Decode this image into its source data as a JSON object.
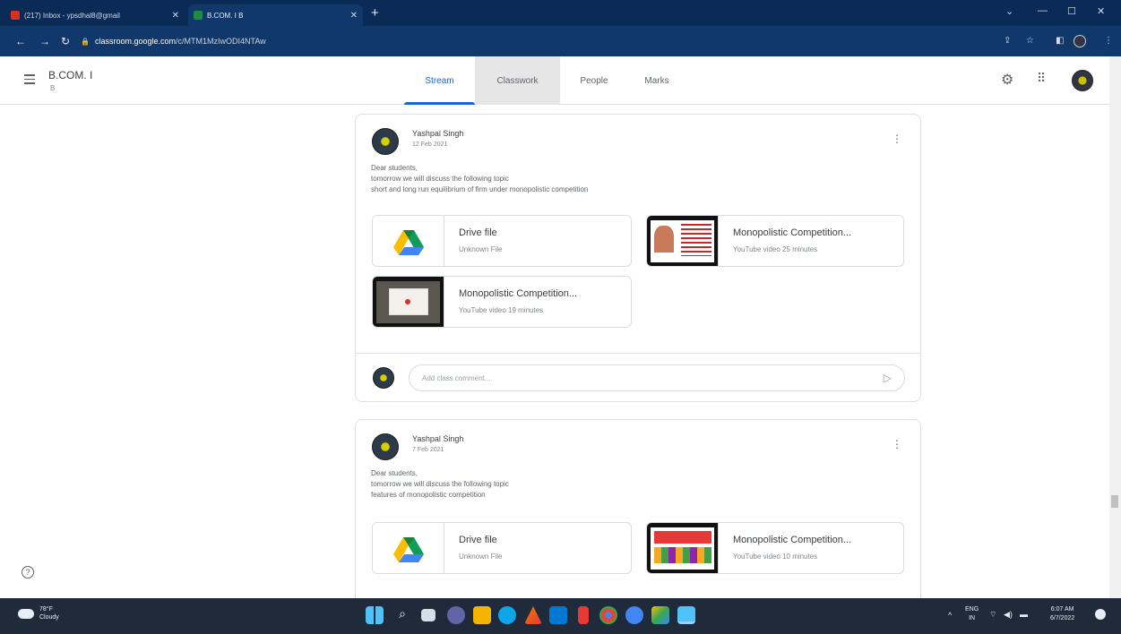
{
  "browser": {
    "tabs": [
      {
        "label": "(217) Inbox - ypsdhal8@gmail",
        "active": false
      },
      {
        "label": "B.COM. I B",
        "active": true
      }
    ],
    "url_host": "classroom.google.com",
    "url_path": "/c/MTM1MzIwODI4NTAw"
  },
  "app": {
    "class_name": "B.COM. I",
    "class_section": "B",
    "tabs": [
      "Stream",
      "Classwork",
      "People",
      "Marks"
    ],
    "active_tab": "Stream",
    "hovered_tab": "Classwork"
  },
  "posts": [
    {
      "author": "Yashpal Singh",
      "date": "12 Feb 2021",
      "lines": [
        "Dear students,",
        "tomorrow we will discuss the following topic",
        "short and long run equilibrium of firm under monopolistic competition"
      ],
      "attachments": [
        {
          "title": "Drive file",
          "subtitle": "Unknown File",
          "kind": "drive"
        },
        {
          "title": "Monopolistic Competition...",
          "subtitle": "YouTube video  25 minutes",
          "kind": "youtube"
        },
        {
          "title": "Monopolistic Competition...",
          "subtitle": "YouTube video  19 minutes",
          "kind": "youtube"
        }
      ],
      "comment_placeholder": "Add class comment..."
    },
    {
      "author": "Yashpal Singh",
      "date": "7 Feb 2021",
      "lines": [
        "Dear students,",
        "tomorrow we will discuss the following topic",
        "features of monopolistic competition"
      ],
      "attachments": [
        {
          "title": "Drive file",
          "subtitle": "Unknown File",
          "kind": "drive"
        },
        {
          "title": "Monopolistic Competition...",
          "subtitle": "YouTube video  10 minutes",
          "kind": "youtube"
        }
      ]
    }
  ],
  "taskbar": {
    "weather_temp": "78°F",
    "weather_desc": "Cloudy",
    "lang_top": "ENG",
    "lang_bottom": "IN",
    "time": "6:07 AM",
    "date": "6/7/2022"
  },
  "colors": {
    "chrome_dark": "#0b2b57",
    "chrome_bar": "#10386b",
    "accent_blue": "#1967d2",
    "taskbar": "#1f2a3a"
  }
}
